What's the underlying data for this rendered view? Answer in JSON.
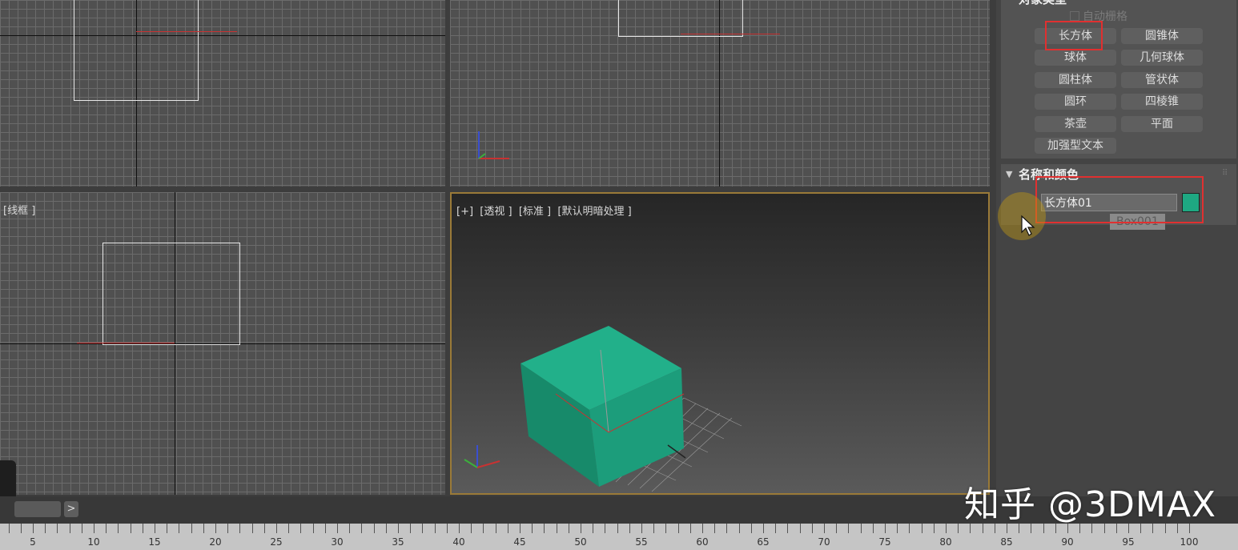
{
  "viewports": {
    "top_left": {
      "label": ""
    },
    "top_right": {
      "label": ""
    },
    "left": {
      "label": "[线框 ]"
    },
    "perspective": {
      "label": "[+]  [透视 ]  [标准 ]  [默认明暗处理 ]"
    }
  },
  "command_panel": {
    "object_type": {
      "header": "对象类型",
      "autogrid_label": "自动栅格",
      "buttons": [
        "长方体",
        "圆锥体",
        "球体",
        "几何球体",
        "圆柱体",
        "管状体",
        "圆环",
        "四棱锥",
        "茶壶",
        "平面",
        "加强型文本"
      ]
    },
    "name_color": {
      "header": "名称和颜色",
      "name_value": "长方体01",
      "tooltip": "Box001",
      "swatch_color": "#1ea882"
    }
  },
  "timeline": {
    "ticks": [
      "5",
      "10",
      "15",
      "20",
      "25",
      "30",
      "35",
      "40",
      "45",
      "50",
      "55",
      "60",
      "65",
      "70",
      "75",
      "80",
      "85",
      "90",
      "95",
      "100"
    ],
    "next_label": ">"
  },
  "watermark": "知乎 @3DMAX",
  "colors": {
    "accent_highlight": "#e03030",
    "active_border": "#9a7a38",
    "box": "#1ea882"
  }
}
